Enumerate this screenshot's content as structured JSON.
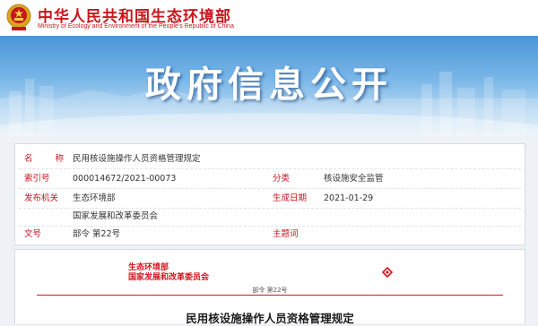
{
  "header": {
    "ministry_name_cn": "中华人民共和国生态环境部",
    "ministry_name_en": "Ministry of Ecology and Environment of the People's Republic of China",
    "emblem_icon": "national-emblem-icon",
    "brand_color": "#c8161d"
  },
  "banner": {
    "title": "政府信息公开",
    "background_colors": [
      "#4a95d8",
      "#dcecf8"
    ]
  },
  "info": {
    "name_label": "名称",
    "name_value": "民用核设施操作人员资格管理规定",
    "index_label": "索引号",
    "index_value": "000014672/2021-00073",
    "category_label": "分类",
    "category_value": "核设施安全监管",
    "issuer_label": "发布机关",
    "issuer_values": [
      "生态环境部",
      "国家发展和改革委员会"
    ],
    "date_label": "生成日期",
    "date_value": "2021-01-29",
    "doc_no_label": "文号",
    "doc_no_value": "部令 第22号",
    "keywords_label": "主题词",
    "keywords_value": ""
  },
  "document": {
    "issuer_line_1": "生态环境部",
    "issuer_line_2": "国家发展和改革委员会",
    "order_number": "部令 第22号",
    "title": "民用核设施操作人员资格管理规定",
    "seal_icon": "seal-mark-icon",
    "accent_color": "#d4141c"
  }
}
